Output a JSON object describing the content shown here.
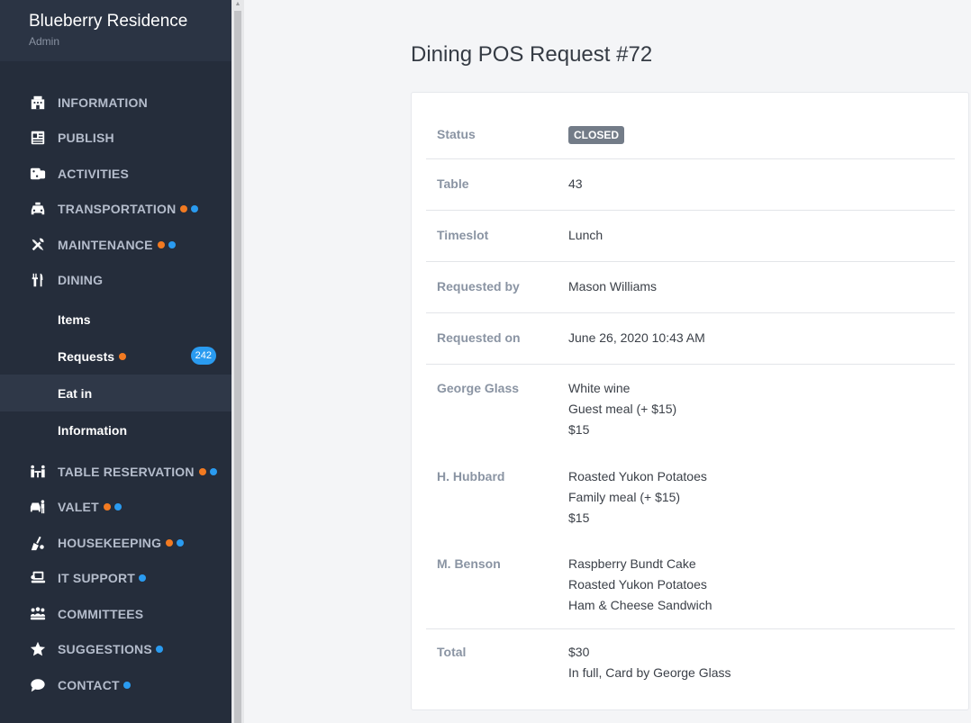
{
  "brand": {
    "name": "Blueberry Residence",
    "role": "Admin"
  },
  "nav": {
    "information": "INFORMATION",
    "publish": "PUBLISH",
    "activities": "ACTIVITIES",
    "transportation": "TRANSPORTATION",
    "maintenance": "MAINTENANCE",
    "dining": "DINING",
    "table_reservation": "TABLE RESERVATION",
    "valet": "VALET",
    "housekeeping": "HOUSEKEEPING",
    "it_support": "IT SUPPORT",
    "committees": "COMMITTEES",
    "suggestions": "SUGGESTIONS",
    "contact": "CONTACT"
  },
  "dining_sub": {
    "items": "Items",
    "requests": "Requests",
    "requests_count": "242",
    "eat_in": "Eat in",
    "information": "Information"
  },
  "page": {
    "title": "Dining POS Request #72"
  },
  "details": {
    "status_label": "Status",
    "status_value": "CLOSED",
    "table_label": "Table",
    "table_value": "43",
    "timeslot_label": "Timeslot",
    "timeslot_value": "Lunch",
    "requested_by_label": "Requested by",
    "requested_by_value": "Mason Williams",
    "requested_on_label": "Requested on",
    "requested_on_value": "June 26, 2020 10:43 AM",
    "guests": [
      {
        "name": "George Glass",
        "lines": [
          "White wine",
          "Guest meal (+ $15)",
          "$15"
        ]
      },
      {
        "name": "H. Hubbard",
        "lines": [
          "Roasted Yukon Potatoes",
          "Family meal (+ $15)",
          "$15"
        ]
      },
      {
        "name": "M. Benson",
        "lines": [
          "Raspberry Bundt Cake",
          "Roasted Yukon Potatoes",
          "Ham & Cheese Sandwich"
        ]
      }
    ],
    "total_label": "Total",
    "total_amount": "$30",
    "total_payment": "In full, Card by George Glass"
  },
  "colors": {
    "sidebar": "#252d3b",
    "accent_blue": "#2a9bf0",
    "accent_orange": "#f27a21",
    "status_closed": "#737c88"
  }
}
